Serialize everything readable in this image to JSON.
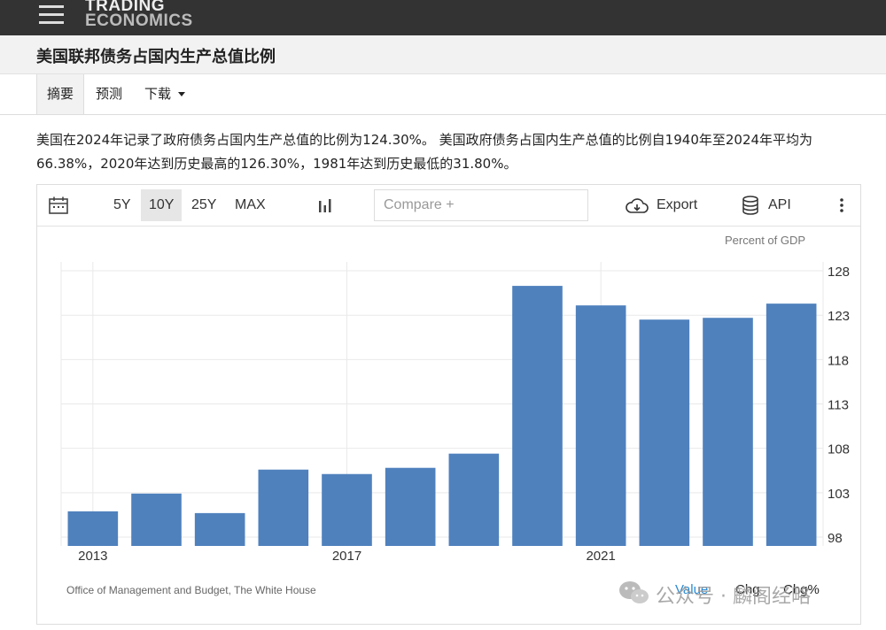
{
  "header": {
    "logo_line1": "TRADING",
    "logo_line2": "ECONOMICS"
  },
  "page_title": "美国联邦债务占国内生产总值比例",
  "tabs": [
    {
      "label": "摘要",
      "active": true
    },
    {
      "label": "预测",
      "active": false
    },
    {
      "label": "下载",
      "active": false
    }
  ],
  "summary": "美国在2024年记录了政府债务占国内生产总值的比例为124.30%。 美国政府债务占国内生产总值的比例自1940年至2024年平均为66.38%，2020年达到历史最高的126.30%，1981年达到历史最低的31.80%。",
  "toolbar": {
    "ranges": [
      "5Y",
      "10Y",
      "25Y",
      "MAX"
    ],
    "active_range": "10Y",
    "compare_placeholder": "Compare +",
    "export_label": "Export",
    "api_label": "API"
  },
  "chart_data": {
    "type": "bar",
    "ylabel": "Percent of GDP",
    "x": [
      2013,
      2014,
      2015,
      2016,
      2017,
      2018,
      2019,
      2020,
      2021,
      2022,
      2023,
      2024
    ],
    "x_tick_labels": [
      "2013",
      "2017",
      "2021"
    ],
    "values": [
      100.9,
      102.9,
      100.7,
      105.6,
      105.1,
      105.8,
      107.4,
      126.3,
      124.1,
      122.5,
      122.7,
      124.3
    ],
    "ylim": [
      97,
      129
    ],
    "y_ticks": [
      98,
      103,
      108,
      113,
      118,
      123,
      128
    ],
    "bar_color": "#4f81bd",
    "grid": true,
    "source": "Office of Management and Budget, The White House"
  },
  "legend": {
    "value_label": "Value",
    "chg_label": "Chg",
    "chgpct_label": "Chg%"
  },
  "colors": {
    "topbar": "#333333",
    "accent_link": "#2a8ad4",
    "bar": "#4f81bd"
  },
  "watermark_text": "公众号 · 麟阁经略"
}
